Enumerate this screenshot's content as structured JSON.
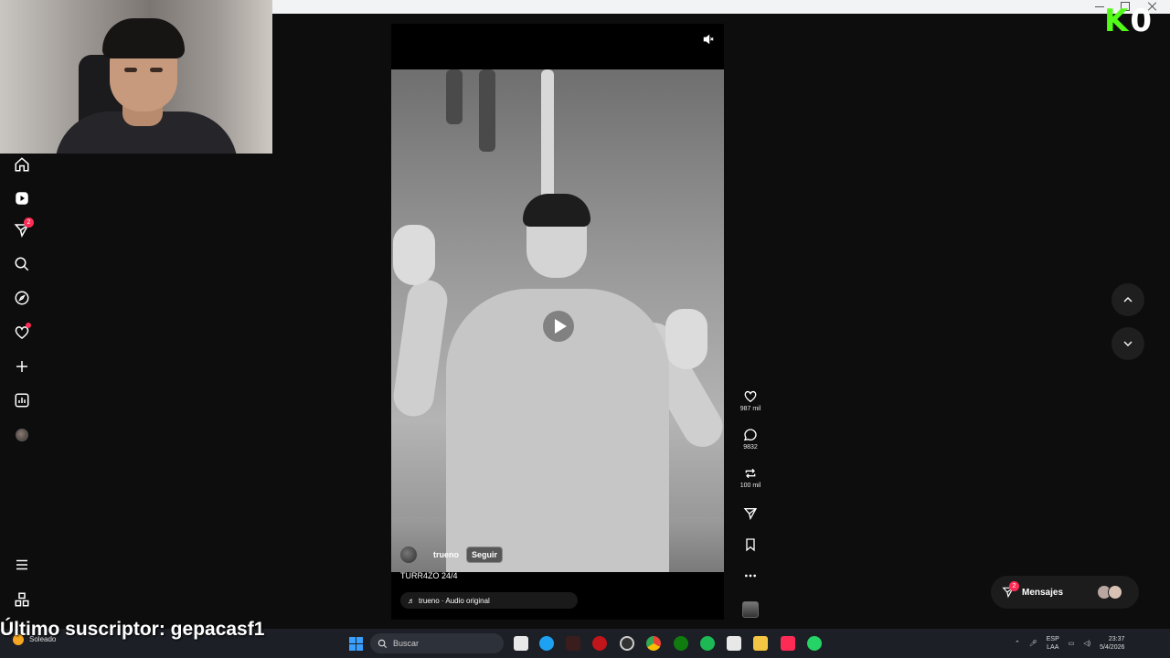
{
  "streamer_overlay": {
    "last_subscriber_text": "Último suscriptor: gepacasf1",
    "logo_letters": [
      "K",
      "0"
    ],
    "logo_color": "#53fc18"
  },
  "sidebar": {
    "items": [
      {
        "name": "home",
        "icon": "home-icon"
      },
      {
        "name": "reels",
        "icon": "reels-icon"
      },
      {
        "name": "messages",
        "icon": "send-icon",
        "badge": "2"
      },
      {
        "name": "search",
        "icon": "search-icon"
      },
      {
        "name": "explore",
        "icon": "compass-icon"
      },
      {
        "name": "notifications",
        "icon": "heart-icon",
        "dot": true
      },
      {
        "name": "create",
        "icon": "plus-icon"
      },
      {
        "name": "dashboard",
        "icon": "chart-icon"
      },
      {
        "name": "profile",
        "icon": "avatar"
      }
    ],
    "bottom": [
      "menu-icon",
      "apps-icon"
    ]
  },
  "video": {
    "author": "trueno",
    "follow_label": "Seguir",
    "caption": "TURR4ZO 24/4",
    "audio_label": "trueno · Audio original",
    "muted": true
  },
  "actions": {
    "likes": "987 mil",
    "comments": "9832",
    "reposts": "100 mil"
  },
  "messages_pill": {
    "label": "Mensajes",
    "badge": "2"
  },
  "taskbar": {
    "weather_temp": "",
    "weather_label": "Soleado",
    "search_placeholder": "Buscar",
    "lang_line1": "ESP",
    "lang_line2": "LAA",
    "time": "23:37",
    "date": "5/4/2026"
  },
  "colors": {
    "accent": "#fe2c55",
    "background": "#0d0d0d",
    "taskbar": "#1c1f26"
  }
}
